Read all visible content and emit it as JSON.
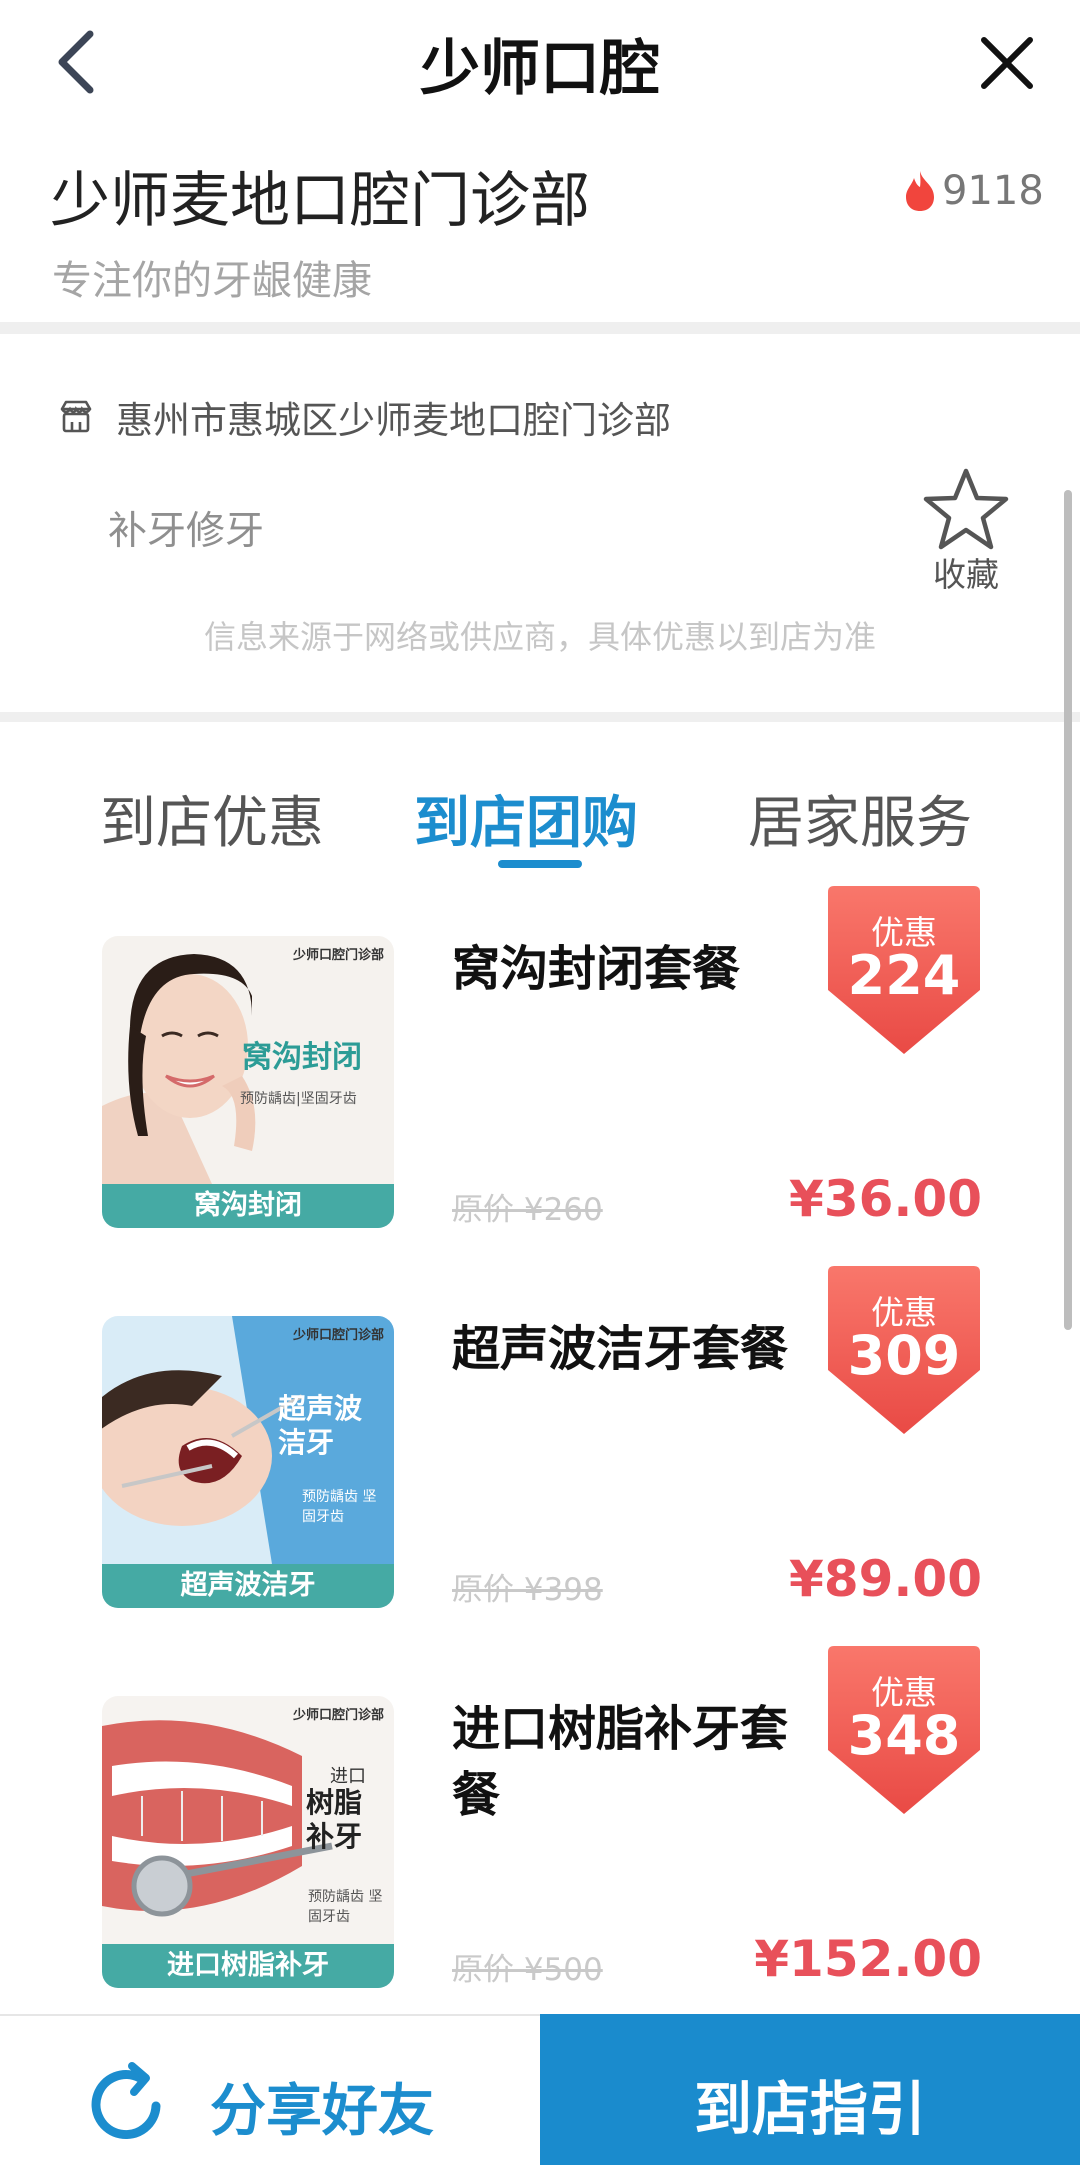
{
  "nav": {
    "title": "少师口腔"
  },
  "clinic": {
    "name": "少师麦地口腔门诊部",
    "slogan": "专注你的牙龈健康",
    "hot_count": "9118"
  },
  "info": {
    "address": "惠州市惠城区少师麦地口腔门诊部",
    "tag": "补牙修牙",
    "favorite_label": "收藏",
    "source_note": "信息来源于网络或供应商，具体优惠以到店为准"
  },
  "tabs": [
    {
      "label": "到店优惠"
    },
    {
      "label": "到店团购",
      "active": true
    },
    {
      "label": "居家服务"
    }
  ],
  "products": [
    {
      "title": "窝沟封闭套餐",
      "original_price": "原价 ¥260",
      "price": "¥36.00",
      "badge_label": "优惠",
      "badge_value": "224",
      "thumb": {
        "logo": "少师口腔门诊部",
        "headline": "窝沟封闭",
        "sub": "预防龋齿|坚固牙齿",
        "caption": "窝沟封闭"
      }
    },
    {
      "title": "超声波洁牙套餐",
      "original_price": "原价 ¥398",
      "price": "¥89.00",
      "badge_label": "优惠",
      "badge_value": "309",
      "thumb": {
        "logo": "少师口腔门诊部",
        "headline": "超声波洁牙",
        "sub": "预防龋齿 坚固牙齿",
        "caption": "超声波洁牙"
      }
    },
    {
      "title": "进口树脂补牙套餐",
      "original_price": "原价 ¥500",
      "price": "¥152.00",
      "badge_label": "优惠",
      "badge_value": "348",
      "thumb": {
        "logo": "少师口腔门诊部",
        "headline_small": "进口",
        "headline": "树脂补牙",
        "sub": "预防龋齿 坚固牙齿",
        "caption": "进口树脂补牙"
      }
    }
  ],
  "bottom": {
    "share_label": "分享好友",
    "guide_label": "到店指引"
  },
  "colors": {
    "accent_blue": "#1c8dce",
    "price_red": "#e8505a",
    "badge_red": "#ee5a52",
    "thumb_teal": "#45aaa4"
  }
}
